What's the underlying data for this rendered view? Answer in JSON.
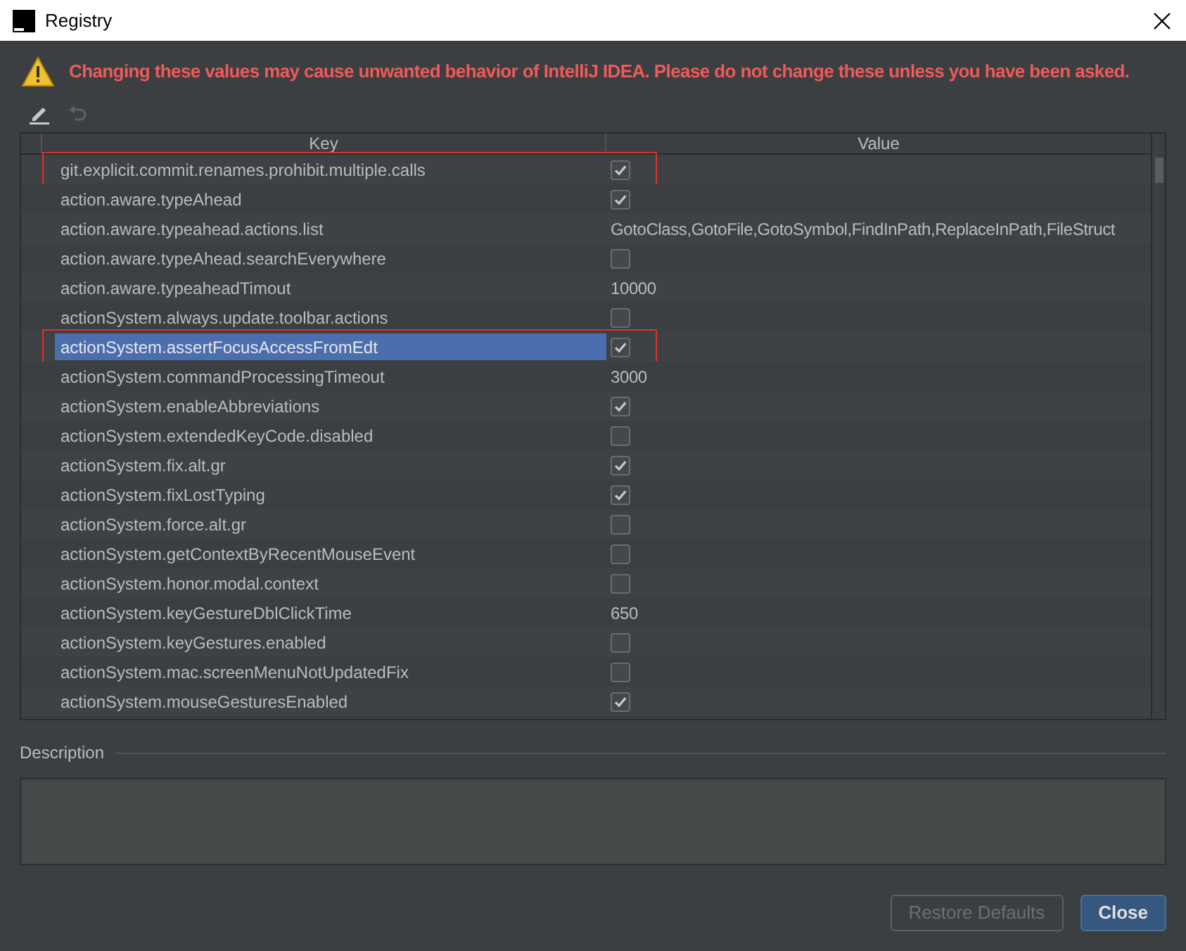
{
  "window": {
    "title": "Registry"
  },
  "warning": "Changing these values may cause unwanted behavior of IntelliJ IDEA. Please do not change these unless you have been asked.",
  "toolbar": [
    {
      "kind": "edit",
      "disabled": false
    },
    {
      "kind": "revert",
      "disabled": true
    }
  ],
  "table": {
    "columns": [
      "Key",
      "Value"
    ],
    "rows": [
      {
        "key": "git.explicit.commit.renames.prohibit.multiple.calls",
        "kind": "checkbox",
        "checked": true,
        "selected": false,
        "highlighted": true
      },
      {
        "key": "action.aware.typeAhead",
        "kind": "checkbox",
        "checked": true,
        "selected": false,
        "highlighted": false
      },
      {
        "key": "action.aware.typeahead.actions.list",
        "kind": "text",
        "value": "GotoClass,GotoFile,GotoSymbol,FindInPath,ReplaceInPath,FileStruct",
        "selected": false,
        "highlighted": false
      },
      {
        "key": "action.aware.typeAhead.searchEverywhere",
        "kind": "checkbox",
        "checked": false,
        "selected": false,
        "highlighted": false
      },
      {
        "key": "action.aware.typeaheadTimout",
        "kind": "text",
        "value": "10000",
        "selected": false,
        "highlighted": false
      },
      {
        "key": "actionSystem.always.update.toolbar.actions",
        "kind": "checkbox",
        "checked": false,
        "selected": false,
        "highlighted": false
      },
      {
        "key": "actionSystem.assertFocusAccessFromEdt",
        "kind": "checkbox",
        "checked": true,
        "selected": true,
        "highlighted": true
      },
      {
        "key": "actionSystem.commandProcessingTimeout",
        "kind": "text",
        "value": "3000",
        "selected": false,
        "highlighted": false
      },
      {
        "key": "actionSystem.enableAbbreviations",
        "kind": "checkbox",
        "checked": true,
        "selected": false,
        "highlighted": false
      },
      {
        "key": "actionSystem.extendedKeyCode.disabled",
        "kind": "checkbox",
        "checked": false,
        "selected": false,
        "highlighted": false
      },
      {
        "key": "actionSystem.fix.alt.gr",
        "kind": "checkbox",
        "checked": true,
        "selected": false,
        "highlighted": false
      },
      {
        "key": "actionSystem.fixLostTyping",
        "kind": "checkbox",
        "checked": true,
        "selected": false,
        "highlighted": false
      },
      {
        "key": "actionSystem.force.alt.gr",
        "kind": "checkbox",
        "checked": false,
        "selected": false,
        "highlighted": false
      },
      {
        "key": "actionSystem.getContextByRecentMouseEvent",
        "kind": "checkbox",
        "checked": false,
        "selected": false,
        "highlighted": false
      },
      {
        "key": "actionSystem.honor.modal.context",
        "kind": "checkbox",
        "checked": false,
        "selected": false,
        "highlighted": false
      },
      {
        "key": "actionSystem.keyGestureDblClickTime",
        "kind": "text",
        "value": "650",
        "selected": false,
        "highlighted": false
      },
      {
        "key": "actionSystem.keyGestures.enabled",
        "kind": "checkbox",
        "checked": false,
        "selected": false,
        "highlighted": false
      },
      {
        "key": "actionSystem.mac.screenMenuNotUpdatedFix",
        "kind": "checkbox",
        "checked": false,
        "selected": false,
        "highlighted": false
      },
      {
        "key": "actionSystem.mouseGesturesEnabled",
        "kind": "checkbox",
        "checked": true,
        "selected": false,
        "highlighted": false
      }
    ]
  },
  "description": {
    "label": "Description"
  },
  "buttons": [
    {
      "label": "Restore Defaults",
      "kind": "secondary",
      "disabled": true
    },
    {
      "label": "Close",
      "kind": "primary",
      "disabled": false
    }
  ]
}
